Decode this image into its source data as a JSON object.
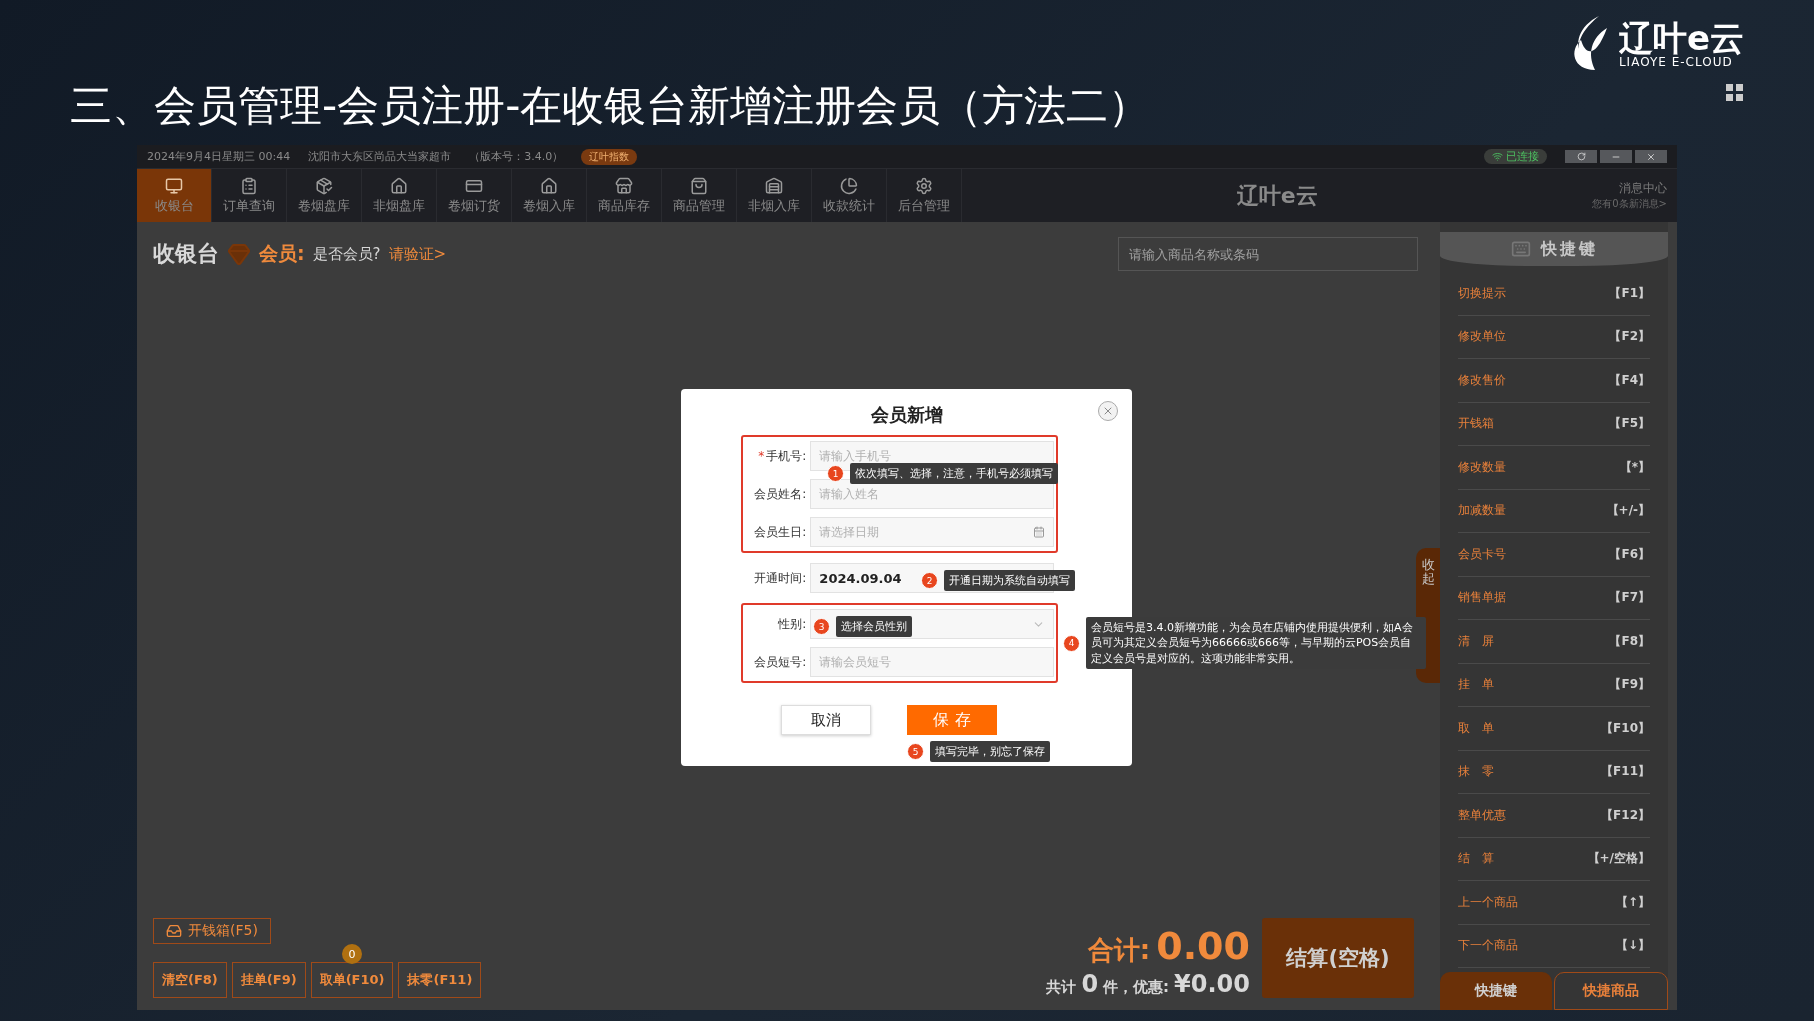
{
  "slide": {
    "title": "三、会员管理-会员注册-在收银台新增注册会员（方法二）"
  },
  "logo": {
    "name": "辽叶e云",
    "tagline": "LIAOYE E-CLOUD"
  },
  "window": {
    "datetime": "2024年9月4日星期三 00:44",
    "store": "沈阳市大东区尚品大当家超市",
    "version": "（版本号：3.4.0）",
    "badge": "辽叶指数",
    "connection": "已连接"
  },
  "toolbar": [
    {
      "label": "收银台",
      "selected": true
    },
    {
      "label": "订单查询",
      "selected": false
    },
    {
      "label": "卷烟盘库",
      "selected": false
    },
    {
      "label": "非烟盘库",
      "selected": false
    },
    {
      "label": "卷烟订货",
      "selected": false
    },
    {
      "label": "卷烟入库",
      "selected": false
    },
    {
      "label": "商品库存",
      "selected": false
    },
    {
      "label": "商品管理",
      "selected": false
    },
    {
      "label": "非烟入库",
      "selected": false
    },
    {
      "label": "收款统计",
      "selected": false
    },
    {
      "label": "后台管理",
      "selected": false
    }
  ],
  "toolbar_logo": "辽叶e云",
  "messages": {
    "title": "消息中心",
    "subtitle": "您有0条新消息>"
  },
  "cashier": {
    "title": "收银台",
    "member_label": "会员:",
    "member_question": "是否会员?",
    "verify_link": "请验证>",
    "search_placeholder": "请输入商品名称或条码"
  },
  "shortcuts": {
    "title": "快捷键",
    "collapse": "收起",
    "items": [
      {
        "label": "切换提示",
        "key": "【F1】"
      },
      {
        "label": "修改单位",
        "key": "【F2】"
      },
      {
        "label": "修改售价",
        "key": "【F4】"
      },
      {
        "label": "开钱箱",
        "key": "【F5】"
      },
      {
        "label": "修改数量",
        "key": "【*】"
      },
      {
        "label": "加减数量",
        "key": "【+/-】"
      },
      {
        "label": "会员卡号",
        "key": "【F6】"
      },
      {
        "label": "销售单据",
        "key": "【F7】"
      },
      {
        "label": "清　屏",
        "key": "【F8】"
      },
      {
        "label": "挂　单",
        "key": "【F9】"
      },
      {
        "label": "取　单",
        "key": "【F10】"
      },
      {
        "label": "抹　零",
        "key": "【F11】"
      },
      {
        "label": "整单优惠",
        "key": "【F12】"
      },
      {
        "label": "结　算",
        "key": "【+/空格】"
      },
      {
        "label": "上一个商品",
        "key": "【↑】"
      },
      {
        "label": "下一个商品",
        "key": "【↓】"
      }
    ],
    "tabs": [
      {
        "label": "快捷键",
        "selected": true
      },
      {
        "label": "快捷商品",
        "selected": false
      }
    ]
  },
  "bottom": {
    "cash_drawer": "开钱箱(F5)",
    "buttons": [
      {
        "label": "清空(F8)"
      },
      {
        "label": "挂单(F9)"
      },
      {
        "label": "取单(F10)",
        "badge": "0"
      },
      {
        "label": "抹零(F11)"
      }
    ],
    "total_label": "合计:",
    "total": "0.00",
    "count_prefix": "共计",
    "count": "0",
    "count_suffix": "件，优惠:",
    "discount": "¥0.00",
    "checkout": "结算(空格)"
  },
  "dialog": {
    "title": "会员新增",
    "required_mark": "*",
    "groups": [
      {
        "highlighted": true,
        "fields": [
          {
            "label": "手机号:",
            "required": true,
            "kind": "input",
            "placeholder": "请输入手机号",
            "callout": {
              "number": "1",
              "text": "依次填写、选择，注意，手机号必须填写"
            }
          },
          {
            "label": "会员姓名:",
            "required": false,
            "kind": "input",
            "placeholder": "请输入姓名"
          },
          {
            "label": "会员生日:",
            "required": false,
            "kind": "date",
            "placeholder": "请选择日期"
          }
        ]
      },
      {
        "highlighted": false,
        "fields": [
          {
            "label": "开通时间:",
            "required": false,
            "kind": "value",
            "value": "2024.09.04",
            "callout": {
              "number": "2",
              "text": "开通日期为系统自动填写"
            }
          }
        ]
      },
      {
        "highlighted": true,
        "callout": {
          "number": "4",
          "text": "会员短号是3.4.0新增功能，为会员在店铺内使用提供便利，如A会员可为其定义会员短号为66666或666等，与早期的云POS会员自定义会员号是对应的。这项功能非常实用。"
        },
        "fields": [
          {
            "label": "性别:",
            "required": false,
            "kind": "select",
            "callout": {
              "number": "3",
              "text": "选择会员性别"
            }
          },
          {
            "label": "会员短号:",
            "required": false,
            "kind": "input",
            "placeholder": "请输会员短号"
          }
        ]
      }
    ],
    "cancel": "取消",
    "save": "保 存",
    "save_callout": {
      "number": "5",
      "text": "填写完毕，别忘了保存"
    }
  }
}
